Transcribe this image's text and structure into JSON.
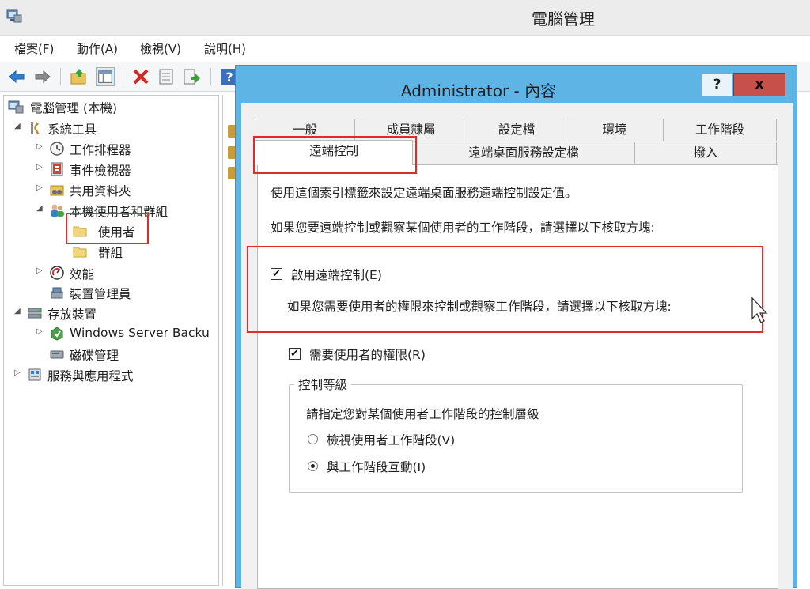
{
  "main_window": {
    "title": "電腦管理"
  },
  "menu": {
    "items": [
      "檔案(F)",
      "動作(A)",
      "檢視(V)",
      "說明(H)"
    ]
  },
  "toolbar": {
    "buttons": [
      "back-icon",
      "forward-icon",
      "up-folder-icon",
      "show-hide-tree-icon",
      "delete-icon",
      "properties-icon",
      "export-icon",
      "help-icon"
    ]
  },
  "tree": {
    "root": "電腦管理 (本機)",
    "system_tools": "系統工具",
    "task_scheduler": "工作排程器",
    "event_viewer": "事件檢視器",
    "shared_folders": "共用資料夾",
    "local_users_groups": "本機使用者和群組",
    "users": "使用者",
    "groups": "群組",
    "performance": "效能",
    "device_manager": "裝置管理員",
    "storage": "存放裝置",
    "windows_server_backup": "Windows Server Backu",
    "disk_management": "磁碟管理",
    "services_apps": "服務與應用程式"
  },
  "dialog": {
    "title": "Administrator - 內容",
    "help_label": "?",
    "close_label": "x",
    "tabs_row1": [
      "一般",
      "成員隸屬",
      "設定檔",
      "環境",
      "工作階段"
    ],
    "tabs_row2": [
      "遠端控制",
      "遠端桌面服務設定檔",
      "撥入"
    ],
    "active_tab": "遠端控制",
    "intro_text": "使用這個索引標籤來設定遠端桌面服務遠端控制設定值。",
    "instruction_text": "如果您要遠端控制或觀察某個使用者的工作階段，請選擇以下核取方塊:",
    "enable_remote_control": {
      "label": "啟用遠端控制(E)",
      "checked": true
    },
    "permission_text": "如果您需要使用者的權限來控制或觀察工作階段，請選擇以下核取方塊:",
    "require_permission": {
      "label": "需要使用者的權限(R)",
      "checked": true
    },
    "control_level": {
      "legend": "控制等級",
      "description": "請指定您對某個使用者工作階段的控制層級",
      "options": [
        {
          "label": "檢視使用者工作階段(V)",
          "selected": false
        },
        {
          "label": "與工作階段互動(I)",
          "selected": true
        }
      ]
    }
  },
  "colors": {
    "dialog_frame": "#5fb4e6",
    "close_button": "#c7504a",
    "highlight_box": "#e02b2b"
  }
}
